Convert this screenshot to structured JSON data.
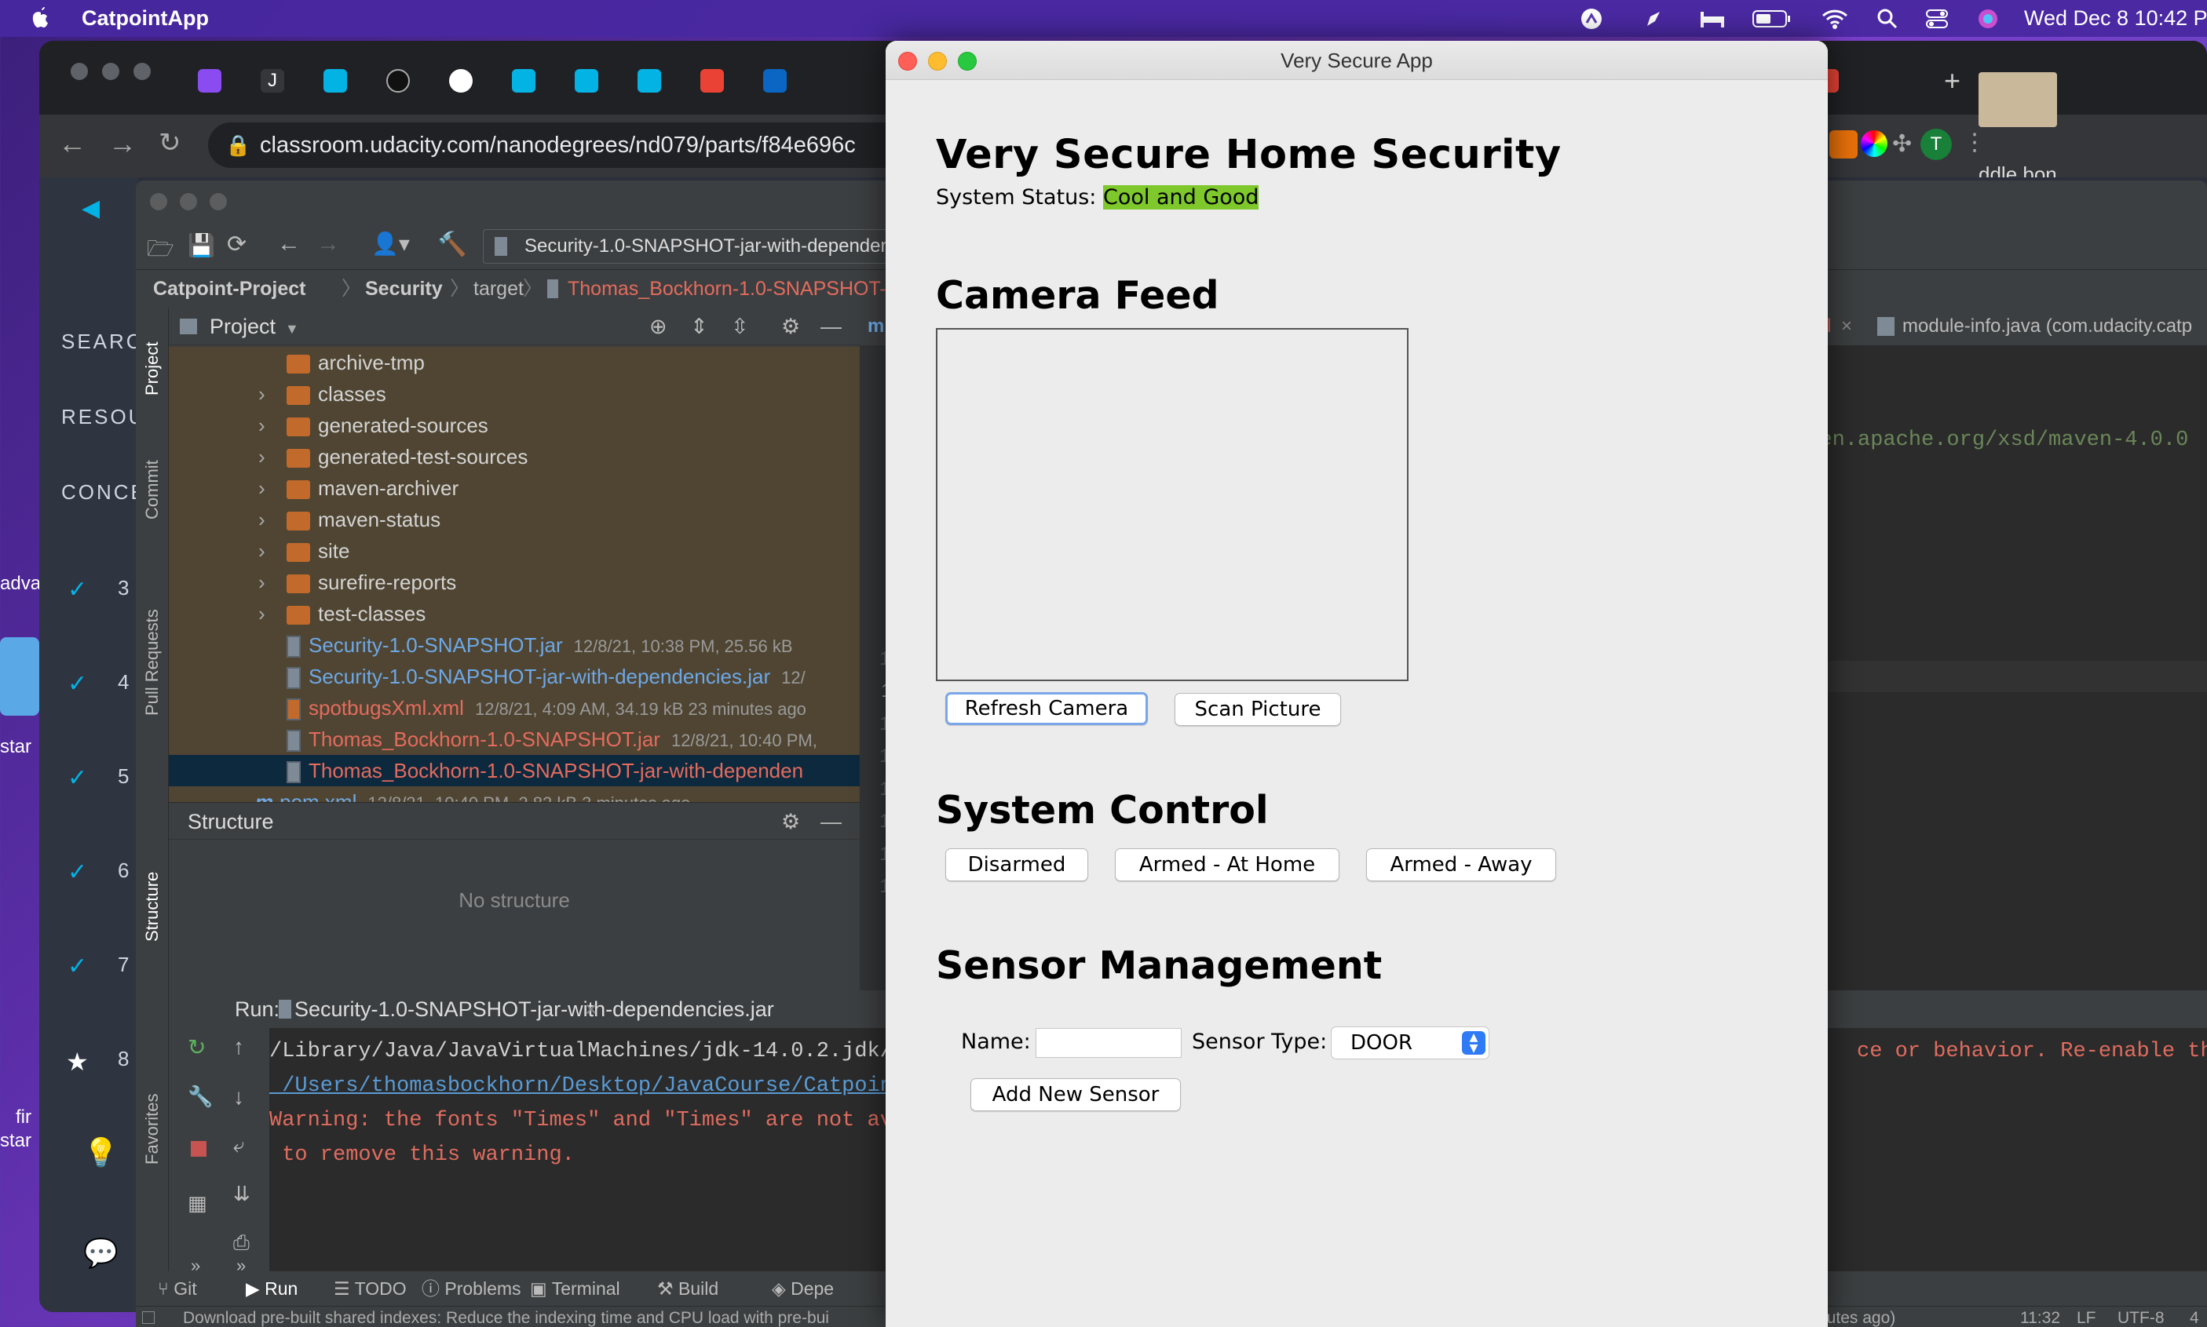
{
  "menubar": {
    "app_name": "CatpointApp",
    "clock": "Wed Dec 8  10:42 PM"
  },
  "browser": {
    "url": "classroom.udacity.com/nanodegrees/nd079/parts/f84e696c",
    "sidebar": {
      "search": "SEARCH",
      "resources": "RESOURCES",
      "concepts": "CONCEPTS",
      "item_numbers": [
        "3",
        "4",
        "5",
        "6",
        "7",
        "8"
      ]
    },
    "right_tab_text": "ddle bon"
  },
  "desktop": {
    "label_adva": "adva",
    "label_star": "star",
    "label_fir": "fir",
    "label_star2": "star"
  },
  "ide": {
    "run_config": "Security-1.0-SNAPSHOT-jar-with-dependenc",
    "breadcrumb": [
      "Catpoint-Project",
      "Security",
      "target",
      "Thomas_Bockhorn-1.0-SNAPSHOT-jar"
    ],
    "project_panel_title": "Project",
    "left_strip": [
      "Project",
      "Commit",
      "Pull Requests",
      "Structure",
      "Favorites"
    ],
    "tree": [
      {
        "name": "archive-tmp",
        "kind": "folder",
        "chev": false
      },
      {
        "name": "classes",
        "kind": "folder",
        "chev": true
      },
      {
        "name": "generated-sources",
        "kind": "folder",
        "chev": true
      },
      {
        "name": "generated-test-sources",
        "kind": "folder",
        "chev": true
      },
      {
        "name": "maven-archiver",
        "kind": "folder",
        "chev": true
      },
      {
        "name": "maven-status",
        "kind": "folder",
        "chev": true
      },
      {
        "name": "site",
        "kind": "folder",
        "chev": true
      },
      {
        "name": "surefire-reports",
        "kind": "folder",
        "chev": true
      },
      {
        "name": "test-classes",
        "kind": "folder",
        "chev": true
      },
      {
        "name": "Security-1.0-SNAPSHOT.jar",
        "kind": "jar",
        "color": "blue",
        "meta": "12/8/21, 10:38 PM, 25.56 kB"
      },
      {
        "name": "Security-1.0-SNAPSHOT-jar-with-dependencies.jar",
        "kind": "jar",
        "color": "blue",
        "meta": "12/"
      },
      {
        "name": "spotbugsXml.xml",
        "kind": "xml",
        "color": "red",
        "meta": "12/8/21, 4:09 AM, 34.19 kB 23 minutes ago"
      },
      {
        "name": "Thomas_Bockhorn-1.0-SNAPSHOT.jar",
        "kind": "jar",
        "color": "red",
        "meta": "12/8/21, 10:40 PM,"
      },
      {
        "name": "Thomas_Bockhorn-1.0-SNAPSHOT-jar-with-dependen",
        "kind": "jar",
        "color": "red",
        "meta": "",
        "selected": true
      },
      {
        "name": "pom.xml",
        "kind": "pom",
        "color": "blue",
        "meta": "12/8/21, 10:40 PM, 2.82 kB 3 minutes ago"
      },
      {
        "name": "src",
        "kind": "folder",
        "chev": true
      }
    ],
    "structure_title": "Structure",
    "structure_empty": "No structure",
    "editor_tabs": [
      "xml",
      "module-info.java (com.udacity.catp"
    ],
    "editor_line_numbers": [
      "1",
      "2",
      "3",
      "4",
      "5",
      "6",
      "7",
      "8",
      "9",
      "10",
      "11",
      "12",
      "13",
      "14",
      "15",
      "16",
      "17"
    ],
    "editor_code_fragment": "aven.apache.org/xsd/maven-4.0.0",
    "run_label": "Run:",
    "run_tab": "Security-1.0-SNAPSHOT-jar-with-dependencies.jar",
    "console": [
      {
        "text": "/Library/Java/JavaVirtualMachines/jdk-14.0.2.jdk/C",
        "kind": "normal"
      },
      {
        "text": " /Users/thomasbockhorn/Desktop/JavaCourse/Catpoint",
        "kind": "link"
      },
      {
        "text": "Warning: the fonts \"Times\" and \"Times\" are not ava",
        "kind": "error"
      },
      {
        "text": " to remove this warning.",
        "kind": "error"
      }
    ],
    "console_right": "ce or behavior. Re-enable the \"T",
    "bottom_tools": [
      "Git",
      "Run",
      "TODO",
      "Problems",
      "Terminal",
      "Build",
      "Depe"
    ],
    "status_text": "Download pre-built shared indexes: Reduce the indexing time and CPU load with pre-bui",
    "status_right": [
      "nutes ago)",
      "11:32",
      "LF",
      "UTF-8",
      "4"
    ]
  },
  "app": {
    "window_title": "Very Secure App",
    "heading": "Very Secure Home Security",
    "status_label": "System Status: ",
    "status_value": "Cool and Good",
    "status_color": "#7ec82c",
    "camera_heading": "Camera Feed",
    "refresh_button": "Refresh Camera",
    "scan_button": "Scan Picture",
    "control_heading": "System Control",
    "arming_buttons": [
      "Disarmed",
      "Armed - At Home",
      "Armed - Away"
    ],
    "sensor_heading": "Sensor Management",
    "name_label": "Name:",
    "name_value": "",
    "type_label": "Sensor Type:",
    "type_value": "DOOR",
    "add_button": "Add New Sensor"
  }
}
